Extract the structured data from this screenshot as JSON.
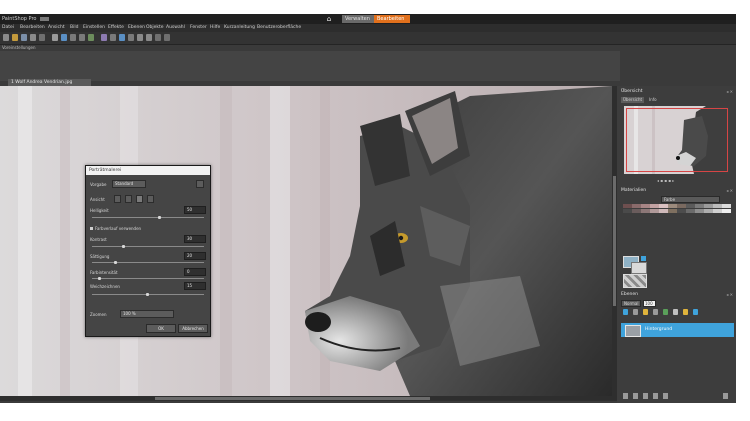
{
  "app": {
    "title": "PaintShop Pro"
  },
  "workspace_tabs": {
    "manage": "Verwalten",
    "edit": "Bearbeiten"
  },
  "menubar": [
    "Datei",
    "Bearbeiten",
    "Ansicht",
    "Bild",
    "Einstellen",
    "Effekte",
    "Ebenen",
    "Objekte",
    "Auswahl",
    "Fenster",
    "Hilfe",
    "Kurzanleitung",
    "Benutzeroberfläche"
  ],
  "options_bar": {
    "label": "Voreinstellungen"
  },
  "document": {
    "tab_label": "1 Wolf Andrea Vendrian.jpg",
    "image_description": "Grauer Wolf im Profil vor verschneitem Wald"
  },
  "dialog": {
    "title": "Porträtmalerei",
    "preset_label": "Vorgabe",
    "preset_value": "Standard",
    "preview_label": "Ansicht",
    "fields": [
      {
        "label": "Helligkeit",
        "value": "50"
      },
      {
        "label": "Kontrast",
        "value": "30"
      },
      {
        "label": "Sättigung",
        "value": "20"
      },
      {
        "label": "Farbintensität",
        "value": "0"
      },
      {
        "label": "Weichzeichnen",
        "value": "15"
      }
    ],
    "checkbox_label": "Farbverlauf verwenden",
    "checkbox_checked": true,
    "zoom_label": "Zoomen",
    "zoom_value": "100 %",
    "ok_label": "OK",
    "cancel_label": "Abbrechen"
  },
  "panels": {
    "overview": {
      "title": "Übersicht",
      "tabs": [
        "Übersicht",
        "Info"
      ]
    },
    "materials": {
      "title": "Materialien",
      "swatch_dropdown": "Farbe"
    },
    "layers": {
      "title": "Ebenen",
      "blend": "Normal",
      "opacity": "100",
      "layer_name": "Hintergrund"
    }
  },
  "colors": {
    "accent_orange": "#e1701c",
    "layer_selected": "#3fa3dc",
    "app_bg": "#3a3a3a"
  }
}
